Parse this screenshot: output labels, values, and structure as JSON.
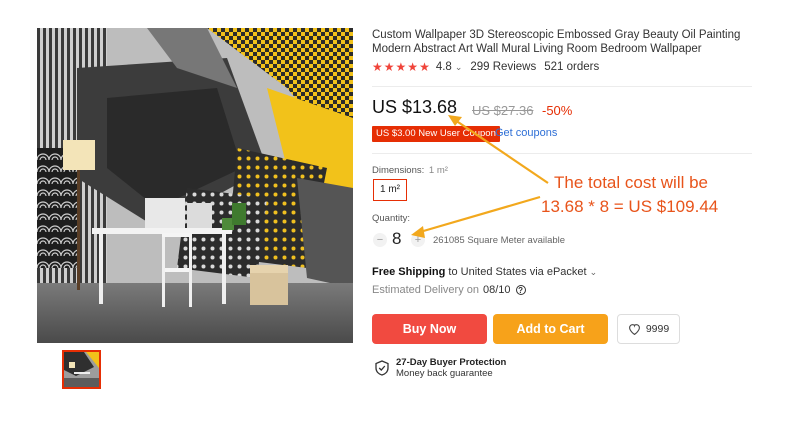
{
  "product": {
    "title": "Custom Wallpaper 3D Stereoscopic Embossed Gray Beauty Oil Painting Modern Abstract Art Wall Mural Living Room Bedroom Wallpaper",
    "rating": "4.8",
    "reviews": "299 Reviews",
    "orders": "521 orders",
    "stars": 5
  },
  "pricing": {
    "price": "US $13.68",
    "old_price": "US $27.36",
    "discount": "-50%",
    "coupon_badge": "US $3.00 New User Coupon",
    "get_coupons": "Get coupons"
  },
  "dimensions": {
    "label": "Dimensions:",
    "selected_value": "1 m²",
    "option": "1 m²"
  },
  "quantity": {
    "label": "Quantity:",
    "minus": "−",
    "value": "8",
    "plus": "+",
    "available": "261085 Square Meter available"
  },
  "shipping": {
    "free_label": "Free Shipping",
    "destination": "to United States via ePacket",
    "delivery_label": "Estimated Delivery on",
    "delivery_date": "08/10"
  },
  "actions": {
    "buy_now": "Buy Now",
    "add_to_cart": "Add to Cart",
    "wishlist_count": "9999"
  },
  "protection": {
    "title": "27-Day Buyer Protection",
    "subtitle": "Money back guarantee"
  },
  "annotation": {
    "line1": "The total cost will be",
    "line2": "13.68 * 8 = US $109.44",
    "color": "#e8541b"
  },
  "colors": {
    "accent_red": "#e62e04",
    "buy_now": "#f14a40",
    "add_to_cart": "#f7a21a",
    "link": "#2e6fd6"
  }
}
